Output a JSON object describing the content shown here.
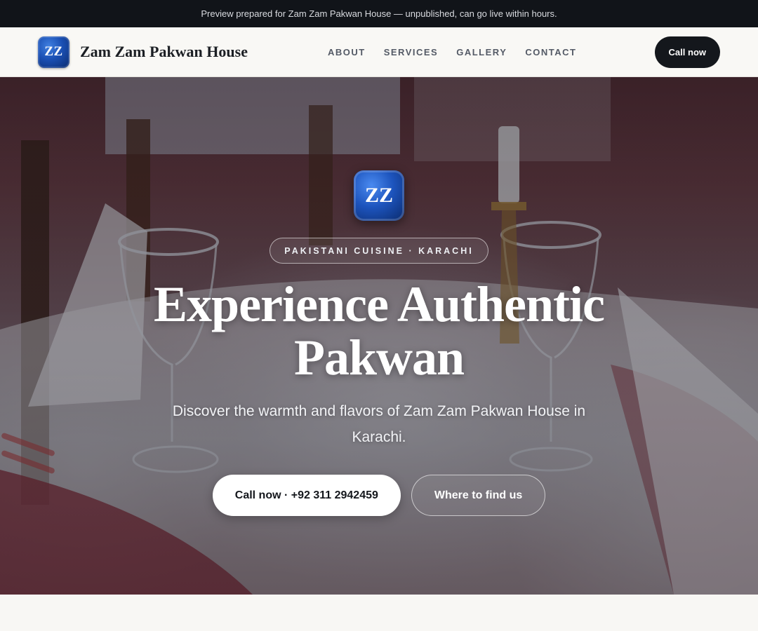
{
  "preview_banner": {
    "text": "Preview prepared for Zam Zam Pakwan House — unpublished, can go live within hours."
  },
  "header": {
    "logo_text": "ZZ",
    "brand_name": "Zam Zam Pakwan House",
    "nav": [
      {
        "label": "ABOUT"
      },
      {
        "label": "SERVICES"
      },
      {
        "label": "GALLERY"
      },
      {
        "label": "CONTACT"
      }
    ],
    "call_button": "Call now"
  },
  "hero": {
    "logo_text": "ZZ",
    "badge": "PAKISTANI CUISINE · KARACHI",
    "title": "Experience Authentic Pakwan",
    "subtitle": "Discover the warmth and flavors of Zam Zam Pakwan House in Karachi.",
    "primary_cta": "Call now · +92 311 2942459",
    "secondary_cta": "Where to find us",
    "background_image": "restaurant-table-setting"
  },
  "colors": {
    "banner_bg": "#111419",
    "header_bg": "#f9f8f5",
    "dark_button": "#14171c",
    "logo_blue": "#1a4fb3",
    "page_bg": "#f8f7f4"
  }
}
